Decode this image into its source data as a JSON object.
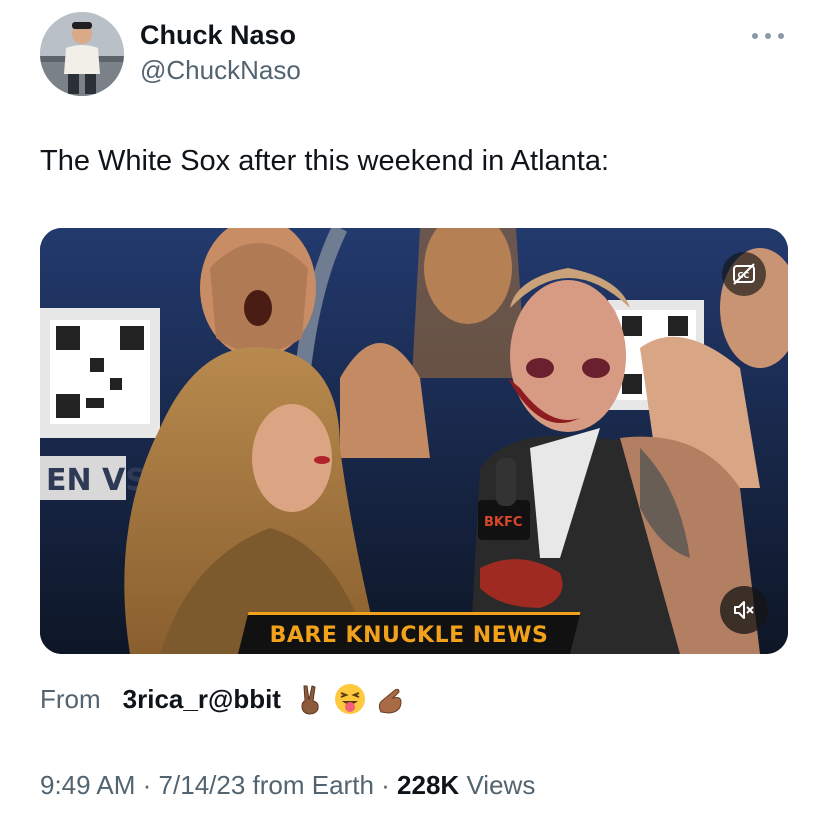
{
  "author": {
    "display_name": "Chuck Naso",
    "handle": "@ChuckNaso"
  },
  "tweet": {
    "text": "The White Sox after this weekend in Atlanta:"
  },
  "media": {
    "banner_text": "BARE KNUCKLE NEWS",
    "backdrop_text": "EN VS",
    "mic_flag_text": "BKFC"
  },
  "attribution": {
    "from_label": "From",
    "source_name": "3rica_r@bbit",
    "emoji_icons": [
      "victory-hand-icon",
      "squinting-tongue-face-icon",
      "pinching-hand-icon"
    ]
  },
  "meta": {
    "time": "9:49 AM",
    "separator": "·",
    "date": "7/14/23",
    "location_text": "from Earth",
    "views_count": "228K",
    "views_label": "Views"
  },
  "colors": {
    "text_primary": "#0f1419",
    "text_secondary": "#536471",
    "banner_accent": "#f2a21a"
  }
}
